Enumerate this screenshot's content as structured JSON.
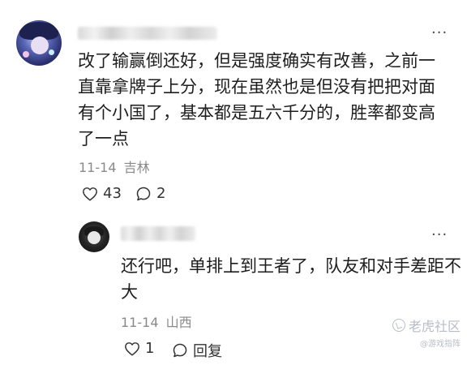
{
  "main_comment": {
    "text": "改了输赢倒还好，但是强度确实有改善，之前一直靠拿牌子上分，现在虽然也是但没有把把对面有个小国了，基本都是五六千分的，胜率都变高了一点",
    "date": "11-14",
    "location": "吉林",
    "likes": "43",
    "replies": "2",
    "more_label": "···"
  },
  "reply_comment": {
    "text": "还行吧，单排上到王者了，队友和对手差距不大",
    "date": "11-14",
    "location": "山西",
    "likes": "1",
    "reply_label": "回复",
    "more_label": "···"
  },
  "watermark": {
    "brand": "老虎社区",
    "sub": "@游戏指阵"
  },
  "icons": [
    "heart-icon",
    "comment-icon",
    "more-icon"
  ]
}
